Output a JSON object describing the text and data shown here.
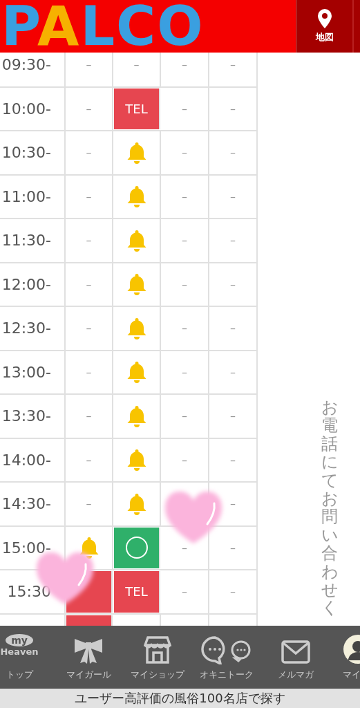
{
  "header": {
    "logo": [
      {
        "text": "P",
        "color": "#3a9fe0"
      },
      {
        "text": "A",
        "color": "#f6b100"
      },
      {
        "text": "LCO",
        "color": "#3a9fe0"
      }
    ],
    "buttons": [
      {
        "label": "地図",
        "kind": "map"
      },
      {
        "kind": "blank"
      }
    ]
  },
  "schedule": {
    "rows": [
      {
        "time": "09:30-",
        "cells": [
          {
            "kind": "dash",
            "text": "–"
          },
          {
            "kind": "dash",
            "text": "–"
          },
          {
            "kind": "dash",
            "text": "–"
          },
          {
            "kind": "dash",
            "text": "–"
          }
        ]
      },
      {
        "time": "10:00-",
        "cells": [
          {
            "kind": "dash",
            "text": "–"
          },
          {
            "kind": "tel",
            "text": "TEL"
          },
          {
            "kind": "dash",
            "text": "–"
          },
          {
            "kind": "dash",
            "text": "–"
          }
        ]
      },
      {
        "time": "10:30-",
        "cells": [
          {
            "kind": "dash",
            "text": "–"
          },
          {
            "kind": "bell"
          },
          {
            "kind": "dash",
            "text": "–"
          },
          {
            "kind": "dash",
            "text": "–"
          }
        ]
      },
      {
        "time": "11:00-",
        "cells": [
          {
            "kind": "dash",
            "text": "–"
          },
          {
            "kind": "bell"
          },
          {
            "kind": "dash",
            "text": "–"
          },
          {
            "kind": "dash",
            "text": "–"
          }
        ]
      },
      {
        "time": "11:30-",
        "cells": [
          {
            "kind": "dash",
            "text": "–"
          },
          {
            "kind": "bell"
          },
          {
            "kind": "dash",
            "text": "–"
          },
          {
            "kind": "dash",
            "text": "–"
          }
        ]
      },
      {
        "time": "12:00-",
        "cells": [
          {
            "kind": "dash",
            "text": "–"
          },
          {
            "kind": "bell"
          },
          {
            "kind": "dash",
            "text": "–"
          },
          {
            "kind": "dash",
            "text": "–"
          }
        ]
      },
      {
        "time": "12:30-",
        "cells": [
          {
            "kind": "dash",
            "text": "–"
          },
          {
            "kind": "bell"
          },
          {
            "kind": "dash",
            "text": "–"
          },
          {
            "kind": "dash",
            "text": "–"
          }
        ]
      },
      {
        "time": "13:00-",
        "cells": [
          {
            "kind": "dash",
            "text": "–"
          },
          {
            "kind": "bell"
          },
          {
            "kind": "dash",
            "text": "–"
          },
          {
            "kind": "dash",
            "text": "–"
          }
        ]
      },
      {
        "time": "13:30-",
        "cells": [
          {
            "kind": "dash",
            "text": "–"
          },
          {
            "kind": "bell"
          },
          {
            "kind": "dash",
            "text": "–"
          },
          {
            "kind": "dash",
            "text": "–"
          }
        ]
      },
      {
        "time": "14:00-",
        "cells": [
          {
            "kind": "dash",
            "text": "–"
          },
          {
            "kind": "bell"
          },
          {
            "kind": "dash",
            "text": "–"
          },
          {
            "kind": "dash",
            "text": "–"
          }
        ]
      },
      {
        "time": "14:30-",
        "cells": [
          {
            "kind": "dash",
            "text": "–"
          },
          {
            "kind": "bell"
          },
          {
            "kind": "empty"
          },
          {
            "kind": "dash",
            "text": "–"
          }
        ]
      },
      {
        "time": "15:00-",
        "cells": [
          {
            "kind": "bell"
          },
          {
            "kind": "circle"
          },
          {
            "kind": "dash",
            "text": "–"
          },
          {
            "kind": "dash",
            "text": "–"
          }
        ]
      },
      {
        "time": "15:30",
        "cells": [
          {
            "kind": "red"
          },
          {
            "kind": "tel",
            "text": "TEL"
          },
          {
            "kind": "dash",
            "text": "–"
          },
          {
            "kind": "dash",
            "text": "–"
          }
        ]
      },
      {
        "cells": [
          {
            "kind": "red"
          },
          {
            "kind": "empty"
          },
          {
            "kind": "empty"
          },
          {
            "kind": "empty"
          }
        ]
      }
    ]
  },
  "side_note": "お電話にてお問い合わせく",
  "nav": [
    {
      "kind": "heaven",
      "label": "トップ",
      "logo_top": "my",
      "logo_bottom": "Heaven"
    },
    {
      "kind": "bow",
      "label": "マイガール"
    },
    {
      "kind": "shop",
      "label": "マイショップ"
    },
    {
      "kind": "chat",
      "label": "オキニトーク"
    },
    {
      "kind": "mail",
      "label": "メルマガ"
    },
    {
      "kind": "avatar",
      "label": "マイ"
    }
  ],
  "banner": "ユーザー高評価の風俗100名店で探す"
}
